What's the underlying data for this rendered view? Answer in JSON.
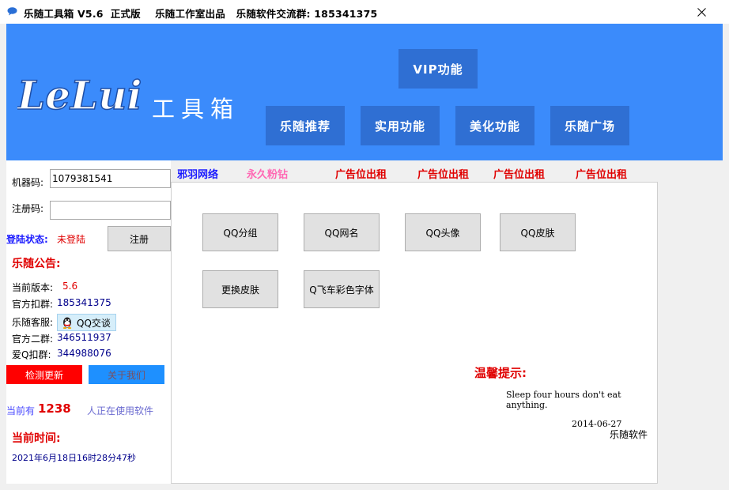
{
  "window": {
    "title": "乐随工具箱 V5.6  正式版    乐随工作室出品   乐随软件交流群: 185341375"
  },
  "banner": {
    "logo_text": "LeLui",
    "logo_suffix": "工具箱",
    "vip_button": "VIP功能",
    "nav": [
      "乐随推荐",
      "实用功能",
      "美化功能",
      "乐随广场"
    ]
  },
  "login": {
    "machine_code_label": "机器码:",
    "machine_code_value": "1079381541",
    "reg_code_label": "注册码:",
    "reg_code_value": "",
    "status_label": "登陆状态:",
    "status_value": "未登陆",
    "register_button": "注册"
  },
  "notice": {
    "title": "乐随公告:",
    "version_label": "当前版本:",
    "version_value": "5.6",
    "group_label": "官方扣群:",
    "group_value": "185341375",
    "service_label": "乐随客服:",
    "qq_chat_button": "QQ交谈",
    "group2_label": "官方二群:",
    "group2_value": "346511937",
    "aiq_label": "爱Q扣群:",
    "aiq_value": "344988076"
  },
  "actions": {
    "update_button": "检测更新",
    "about_button": "关于我们"
  },
  "online": {
    "prefix": "当前有",
    "count": "1238",
    "suffix": "人正在使用软件"
  },
  "time": {
    "label": "当前时间:",
    "value": "2021年6月18日16时28分47秒"
  },
  "ads": {
    "items": [
      "邪羽网络",
      "永久粉钻",
      "广告位出租",
      "广告位出租",
      "广告位出租",
      "广告位出租"
    ],
    "colors": [
      "#1a1aff",
      "#ff69b4",
      "#e00000",
      "#e00000",
      "#e00000",
      "#e00000"
    ]
  },
  "features": [
    "QQ分组",
    "QQ网名",
    "QQ头像",
    "QQ皮肤",
    "更换皮肤",
    "Q飞车彩色字体"
  ],
  "tip": {
    "title": "温馨提示:",
    "text": "Sleep four hours don't eat anything.",
    "date": "2014-06-27",
    "signature": "乐随软件"
  }
}
